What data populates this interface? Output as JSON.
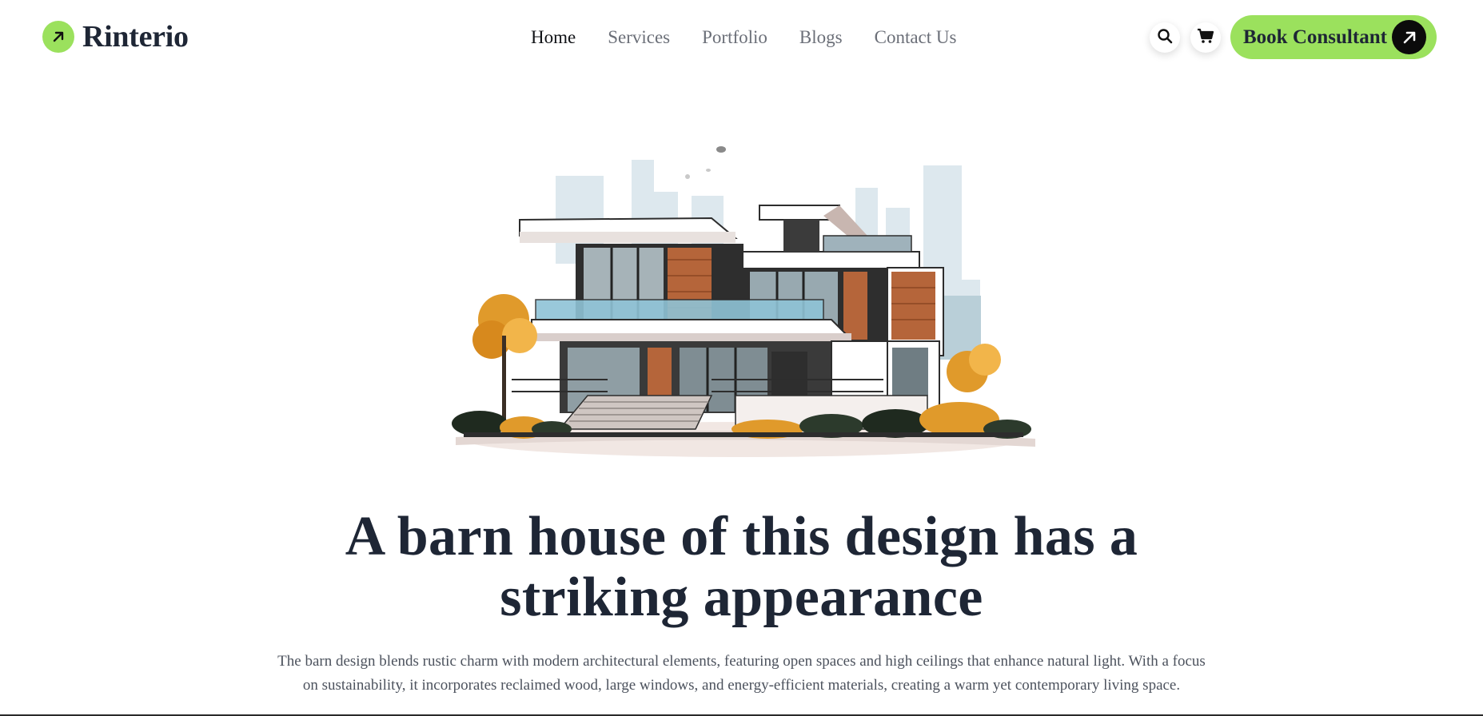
{
  "brand": {
    "name": "Rinterio",
    "logo_icon": "arrow-up-right-icon",
    "accent": "#9be15d"
  },
  "nav": {
    "items": [
      {
        "label": "Home",
        "active": true
      },
      {
        "label": "Services",
        "active": false
      },
      {
        "label": "Portfolio",
        "active": false
      },
      {
        "label": "Blogs",
        "active": false
      },
      {
        "label": "Contact Us",
        "active": false
      }
    ]
  },
  "header_actions": {
    "search_icon": "search-icon",
    "cart_icon": "cart-icon",
    "cta_label": "Book Consultant",
    "cta_icon": "arrow-up-right-icon"
  },
  "hero": {
    "image_subject": "modern two-storey house illustration",
    "title": "A barn house of this design has a striking appearance",
    "description": "The barn design blends rustic charm with modern architectural elements, featuring open spaces and high ceilings that enhance natural light. With a focus on sustainability, it incorporates reclaimed wood, large windows, and energy-efficient materials, creating a warm yet contemporary living space."
  },
  "colors": {
    "text_dark": "#1e2635",
    "text_muted": "#6b6f78",
    "accent_green": "#9be15d"
  }
}
